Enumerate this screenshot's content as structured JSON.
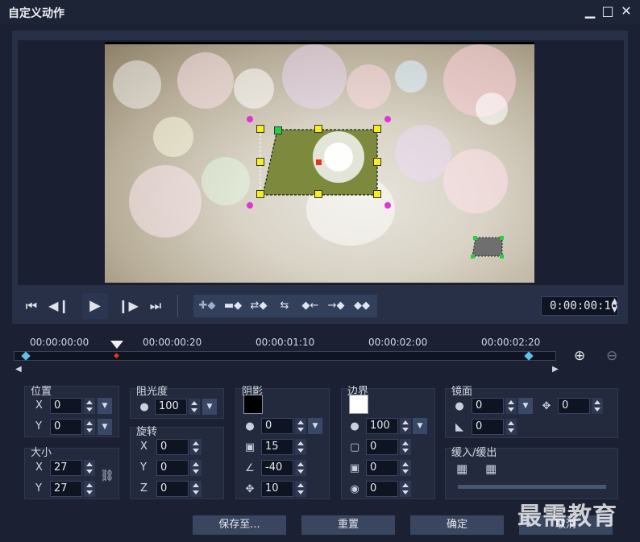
{
  "window": {
    "title": "自定义动作",
    "minimize": "▁",
    "maximize": "□",
    "close": "✕"
  },
  "playback": {
    "timecode": "0:00:00:16"
  },
  "timeline": {
    "labels": [
      "00:00:00:00",
      "00:00:00:20",
      "00:00:01:10",
      "00:00:02:00",
      "00:00:02:20"
    ]
  },
  "position": {
    "title": "位置",
    "x_label": "X",
    "x_value": "0",
    "y_label": "Y",
    "y_value": "0"
  },
  "size": {
    "title": "大小",
    "x_label": "X",
    "x_value": "27",
    "y_label": "Y",
    "y_value": "27"
  },
  "opacity": {
    "title": "阻光度",
    "value": "100"
  },
  "rotation": {
    "title": "旋转",
    "x_label": "X",
    "x_value": "0",
    "y_label": "Y",
    "y_value": "0",
    "z_label": "Z",
    "z_value": "0"
  },
  "shadow": {
    "title": "阴影",
    "color": "#000000",
    "opacity_value": "0",
    "blur_value": "15",
    "angle_value": "-40",
    "distance_value": "10"
  },
  "border": {
    "title": "边界",
    "color": "#ffffff",
    "opacity_value": "100",
    "width_value": "0",
    "blur_value": "0",
    "radius_value": "0"
  },
  "mirror": {
    "title": "镜面",
    "opacity_value": "0",
    "offset_value": "0",
    "fade_value": "0"
  },
  "easing": {
    "title": "缓入/缓出"
  },
  "buttons": {
    "save": "保存至...",
    "reset": "重置",
    "ok": "确定",
    "cancel": "取消"
  },
  "watermark": "最需教育"
}
